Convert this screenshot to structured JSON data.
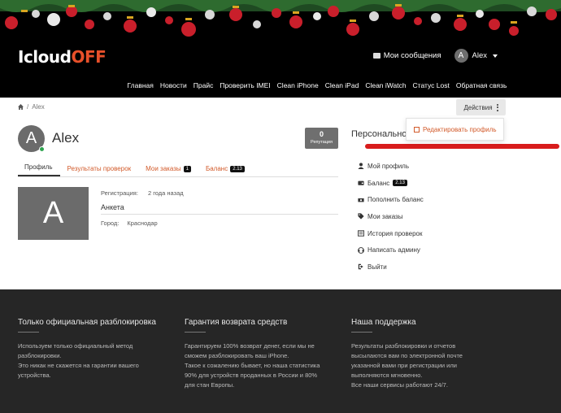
{
  "header": {
    "logo_main": "Icloud",
    "logo_accent": "OFF",
    "messages_label": "Мои сообщения",
    "user_initial": "A",
    "user_name": "Alex",
    "nav": [
      "Главная",
      "Новости",
      "Прайс",
      "Проверить IMEI",
      "Clean iPhone",
      "Clean iPad",
      "Clean iWatch",
      "Статус Lost",
      "Обратная связь"
    ]
  },
  "breadcrumb": {
    "separator": "/",
    "current": "Alex"
  },
  "actions": {
    "label": "Действия",
    "dropdown_item": "Редактировать профиль"
  },
  "profile": {
    "initial": "A",
    "name": "Alex",
    "reputation_value": "0",
    "reputation_label": "Репутация",
    "tabs": [
      {
        "label": "Профиль",
        "badge": ""
      },
      {
        "label": "Результаты проверок",
        "badge": ""
      },
      {
        "label": "Мои заказы",
        "badge": "1"
      },
      {
        "label": "Баланс",
        "badge": "2.13"
      }
    ],
    "reg_label": "Регистрация:",
    "reg_value": "2 года назад",
    "anketa_title": "Анкета",
    "city_label": "Город:",
    "city_value": "Краснодар"
  },
  "sidebar": {
    "title": "Персональное",
    "items": [
      {
        "label": "Мой профиль",
        "badge": "",
        "icon": "user-icon"
      },
      {
        "label": "Баланс",
        "badge": "2.13",
        "icon": "wallet-icon"
      },
      {
        "label": "Пополнить баланс",
        "badge": "",
        "icon": "money-icon"
      },
      {
        "label": "Мои заказы",
        "badge": "",
        "icon": "tag-icon"
      },
      {
        "label": "История проверок",
        "badge": "",
        "icon": "list-icon"
      },
      {
        "label": "Написать админу",
        "badge": "",
        "icon": "support-icon"
      },
      {
        "label": "Выйти",
        "badge": "",
        "icon": "logout-icon"
      }
    ]
  },
  "footer": {
    "columns": [
      {
        "title": "Только официальная разблокировка",
        "lines": [
          "Используем только официальный метод",
          "разблокировки.",
          "Это никак не скажется на гарантии вашего",
          "устройства."
        ]
      },
      {
        "title": "Гарантия возврата средств",
        "lines": [
          "Гарантируем 100% возврат денег, если мы не",
          "сможем разблокировать ваш iPhone.",
          "Такое к сожалению бывает, но наша статистика",
          "90% для устройств проданных в России и 80%",
          "для стан Европы."
        ]
      },
      {
        "title": "Наша поддержка",
        "lines": [
          "Результаты разблокировки и отчетов",
          "высылаются вам по электронной почте",
          "указанной вами при регистрации или",
          "выполняются мгновенно.",
          "Все наши сервисы работают 24/7."
        ]
      }
    ]
  },
  "colors": {
    "accent": "#e8502a",
    "link": "#d25a2a",
    "header_bg": "#000000",
    "footer_bg": "#262626",
    "highlight": "#d81c1c"
  }
}
